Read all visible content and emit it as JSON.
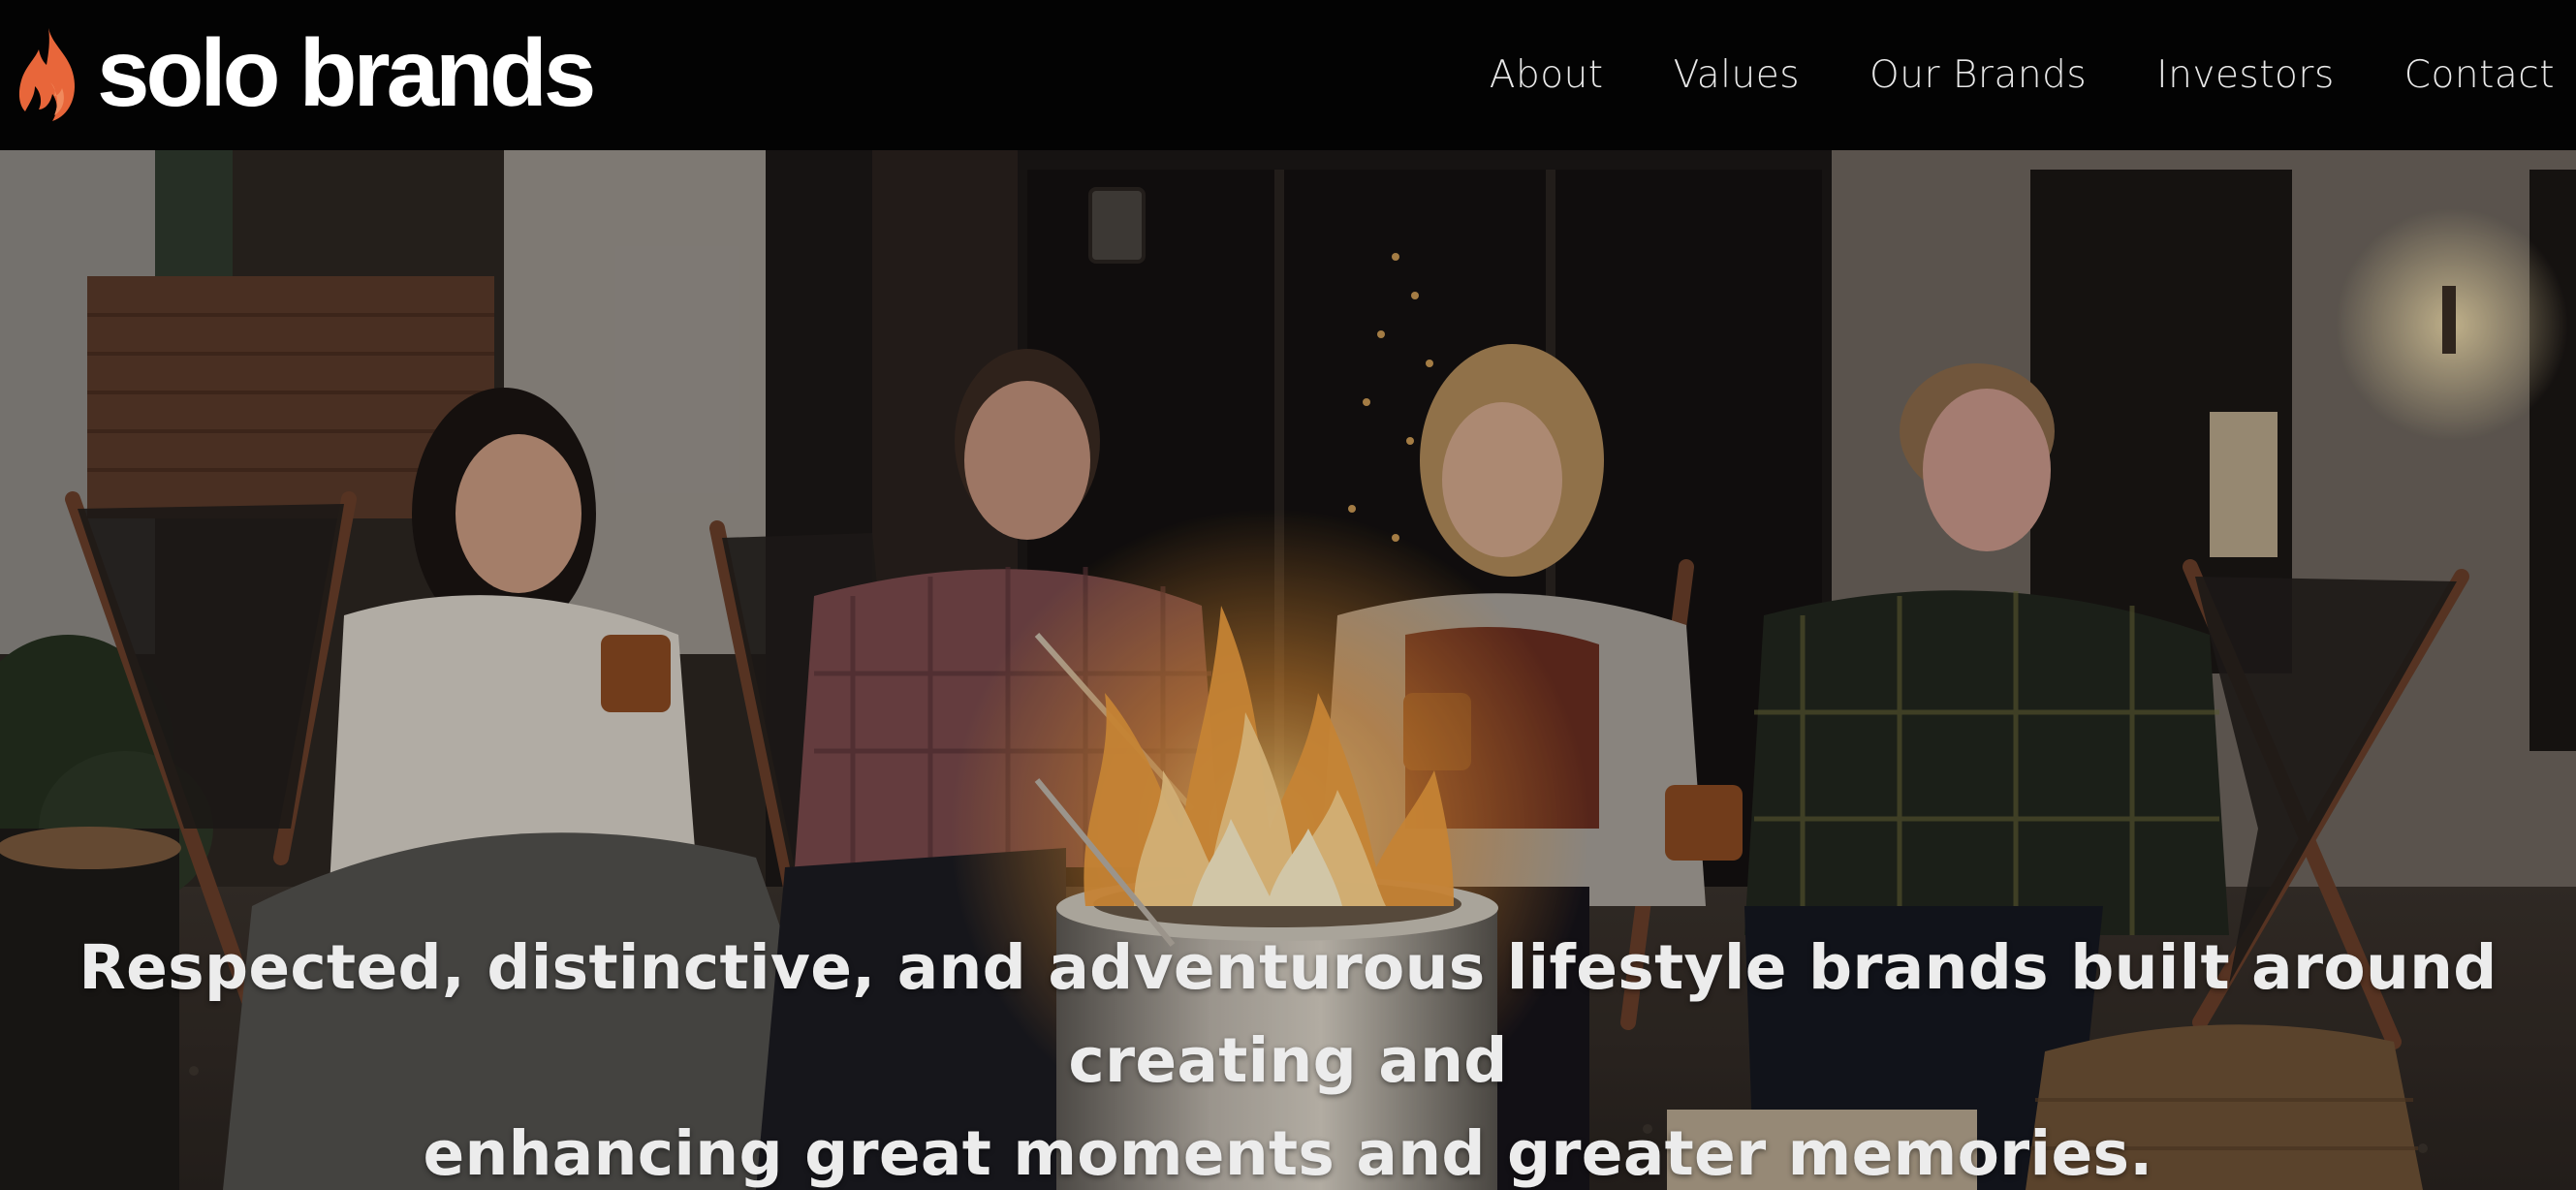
{
  "brand": {
    "name": "solo brands",
    "logo_icon": "flame-icon",
    "flame_color": "#e8663a"
  },
  "nav": {
    "items": [
      {
        "label": "About"
      },
      {
        "label": "Values"
      },
      {
        "label": "Our Brands"
      },
      {
        "label": "Investors"
      },
      {
        "label": "Contact"
      }
    ]
  },
  "hero": {
    "image_description": "photo",
    "headline_line1": "Respected, distinctive, and adventurous lifestyle brands built around creating and",
    "headline_line2": "enhancing great moments and greater memories."
  },
  "colors": {
    "header_bg": "#030303",
    "nav_text": "#e8e8e8",
    "headline_text": "#ececec"
  }
}
